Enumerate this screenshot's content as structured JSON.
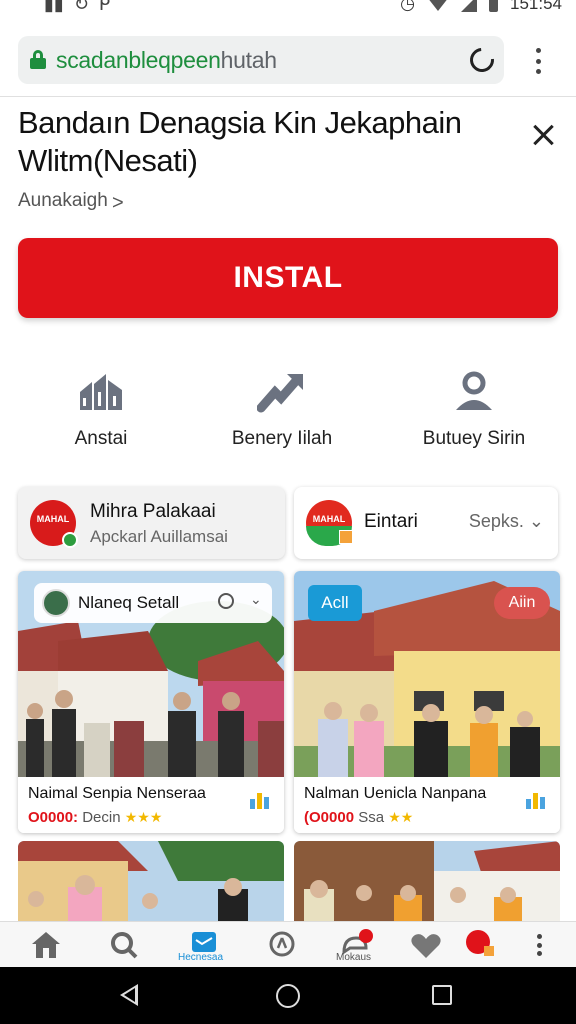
{
  "status_bar": {
    "icons": [
      "sim-icon",
      "sync-icon",
      "location-icon",
      "alarm-icon",
      "wifi-icon",
      "signal-icon",
      "battery-icon"
    ],
    "time": "151:54"
  },
  "browser": {
    "url_domain": "scadanbleqpeen",
    "url_path": "hutah",
    "reload_icon": "reload-icon",
    "menu_icon": "more-vert-icon"
  },
  "listing": {
    "title": "Bandaın Denagsia Kin Jekaphain Wlitm(Nesati)",
    "breadcrumb": "Aunakaigh",
    "breadcrumb_chevron": ">",
    "install_label": "INSTAL",
    "install_color": "#e0131a"
  },
  "actions": [
    {
      "label": "Anstai",
      "icon": "buildings-icon"
    },
    {
      "label": "Benery Iilah",
      "icon": "trend-arrow-icon"
    },
    {
      "label": "Butuey Sirin",
      "icon": "person-icon"
    }
  ],
  "chips": [
    {
      "title": "Mihra Palakaai",
      "subtitle": "Apckarl Auillamsai",
      "badge_text": "MAHAL"
    },
    {
      "title": "Eintari",
      "selector": "Sepks.",
      "badge_text": "MAHAL"
    }
  ],
  "cards": [
    {
      "overlay": "Nlaneq Setall",
      "title": "Naimal Senpia Nenseraa",
      "price": "O0000:",
      "sub": "Decin",
      "stars": "★★★"
    },
    {
      "tag_left": "Acll",
      "tag_right": "Aiin",
      "title": "Nalman Uenicla Nanpana",
      "price": "(O0000",
      "sub": "Ssa",
      "stars": "★★"
    }
  ],
  "bottom_nav": [
    {
      "icon": "home-icon"
    },
    {
      "icon": "search-icon"
    },
    {
      "icon": "app-icon",
      "label": "Hecnesaa"
    },
    {
      "icon": "compass-icon"
    },
    {
      "icon": "chat-icon",
      "label": "Mokaus"
    },
    {
      "icon": "heart-icon"
    },
    {
      "icon": "brand-icon"
    }
  ],
  "system_nav": [
    "back-icon",
    "home-circle-icon",
    "recents-icon"
  ]
}
